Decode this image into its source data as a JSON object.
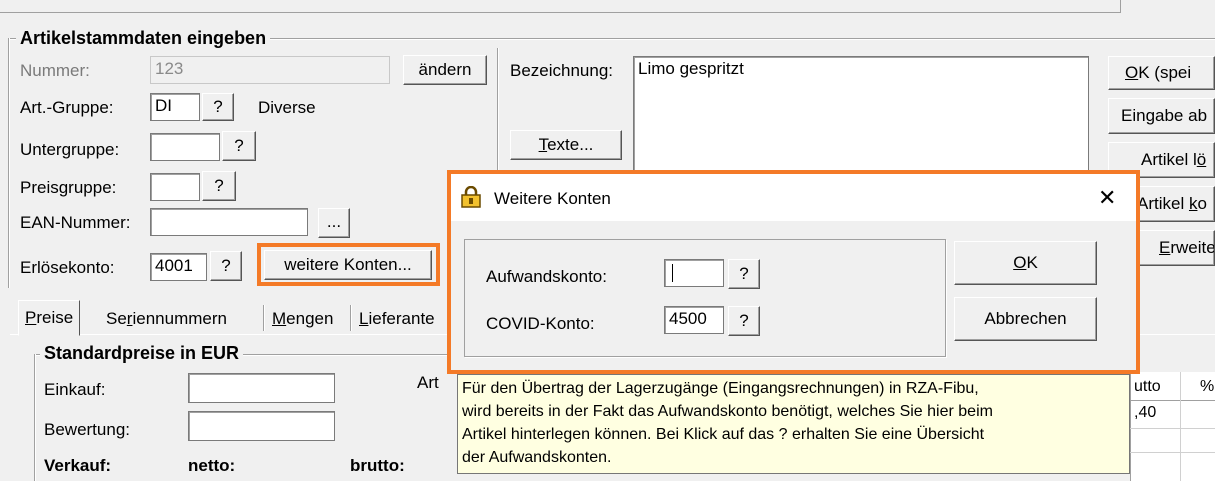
{
  "colors": {
    "highlight": "#f47a27",
    "tooltip_bg": "#ffffe1"
  },
  "form": {
    "title": "Artikelstammdaten eingeben",
    "nummer_label": "Nummer:",
    "nummer_value": "123",
    "aendern_label": "ändern",
    "artgruppe_label": "Art.-Gruppe:",
    "artgruppe_value": "DI",
    "artgruppe_desc": "Diverse",
    "untergruppe_label": "Untergruppe:",
    "preisgruppe_label": "Preisgruppe:",
    "ean_label": "EAN-Nummer:",
    "ean_btn": "...",
    "erloes_label": "Erlösekonto:",
    "erloes_value": "4001",
    "weitere_btn": "weitere Konten...",
    "help_q": "?",
    "bezeichnung_label": "Bezeichnung:",
    "bezeichnung_value": "Limo gespritzt",
    "texte_btn": "Texte..."
  },
  "right_buttons": [
    "OK (spei",
    "Eingabe ab",
    "Artikel lö",
    "Artikel ko",
    "Erweite"
  ],
  "tabs": [
    "Preise",
    "Seriennummern",
    "Mengen",
    "Lieferante"
  ],
  "prices": {
    "title": "Standardpreise in EUR",
    "einkauf": "Einkauf:",
    "bewertung": "Bewertung:",
    "verkauf": "Verkauf:",
    "netto": "netto:",
    "brutto": "brutto:",
    "art_partial": "Art",
    "col_partial": "utto",
    "col_pct": "%",
    "val_partial": ",40"
  },
  "dialog": {
    "title": "Weitere Konten",
    "close": "✕",
    "aufwand_label": "Aufwandskonto:",
    "aufwand_value": "",
    "covid_label": "COVID-Konto:",
    "covid_value": "4500",
    "ok_label": "OK",
    "cancel_label": "Abbrechen"
  },
  "tooltip": {
    "lines": [
      "Für den Übertrag der Lagerzugänge (Eingangsrechnungen) in RZA-Fibu,",
      "wird bereits in der Fakt das Aufwandskonto benötigt, welches Sie hier beim",
      "Artikel hinterlegen können. Bei Klick auf das ? erhalten Sie eine Übersicht",
      "der Aufwandskonten."
    ]
  }
}
